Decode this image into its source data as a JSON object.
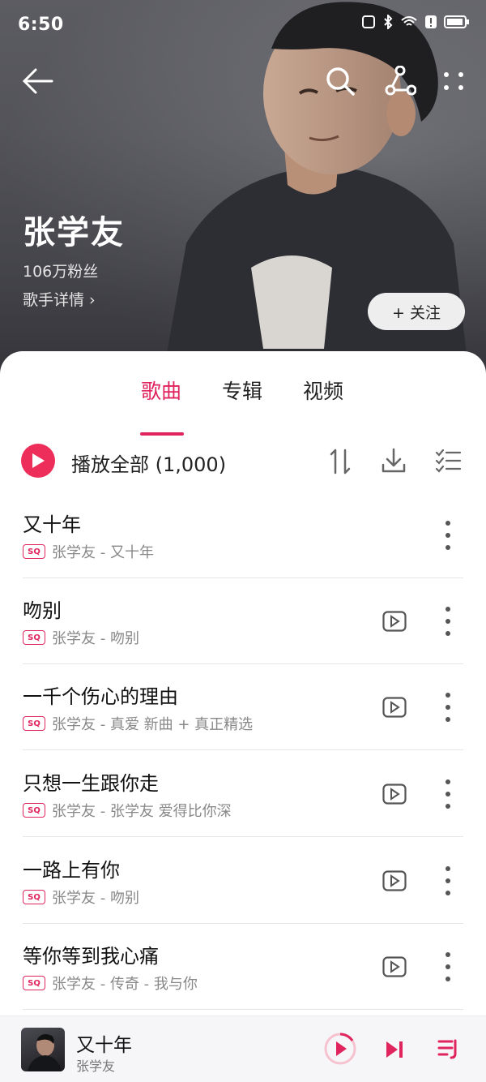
{
  "status_bar": {
    "time": "6:50"
  },
  "artist": {
    "name": "张学友",
    "fans": "106万粉丝",
    "details_link": "歌手详情 ›",
    "follow_label": "+ 关注"
  },
  "tabs": [
    {
      "label": "歌曲",
      "active": true
    },
    {
      "label": "专辑",
      "active": false
    },
    {
      "label": "视频",
      "active": false
    }
  ],
  "play_all": {
    "label": "播放全部 (1,000)"
  },
  "songs": [
    {
      "title": "又十年",
      "subtitle": "张学友 - 又十年",
      "has_mv": false
    },
    {
      "title": "吻别",
      "subtitle": "张学友 - 吻别",
      "has_mv": true
    },
    {
      "title": "一千个伤心的理由",
      "subtitle": "张学友 - 真爱 新曲 + 真正精选",
      "has_mv": true
    },
    {
      "title": "只想一生跟你走",
      "subtitle": "张学友 - 张学友 爱得比你深",
      "has_mv": true
    },
    {
      "title": "一路上有你",
      "subtitle": "张学友 - 吻别",
      "has_mv": true
    },
    {
      "title": "等你等到我心痛",
      "subtitle": "张学友 - 传奇 - 我与你",
      "has_mv": true
    }
  ],
  "quality_badge": "SQ",
  "mini_player": {
    "title": "又十年",
    "artist": "张学友"
  },
  "colors": {
    "accent": "#e0245e",
    "play": "#ee2e5a"
  },
  "icons": [
    "back-icon",
    "search-icon",
    "share-icon",
    "more-icon",
    "sort-icon",
    "download-icon",
    "multi-select-icon",
    "mv-icon",
    "play-icon",
    "next-icon",
    "playlist-icon"
  ]
}
